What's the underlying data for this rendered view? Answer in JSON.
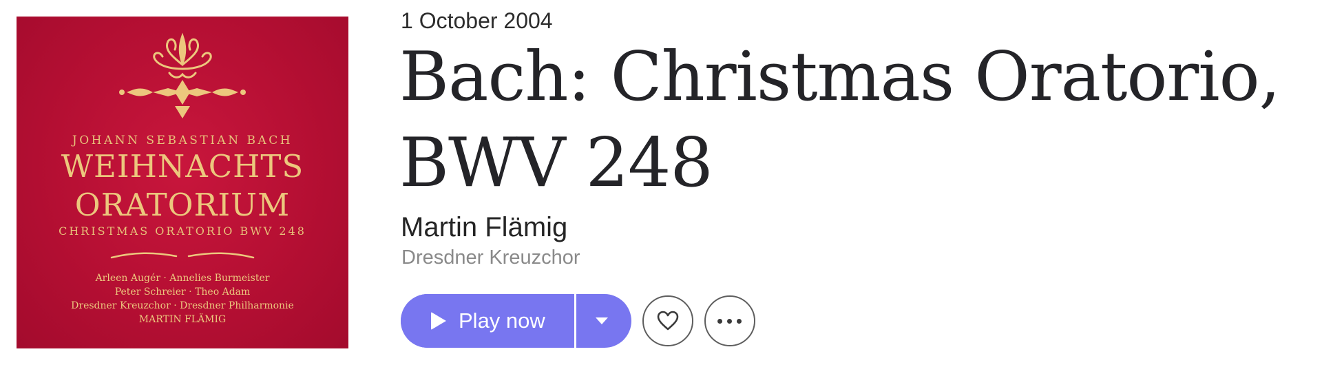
{
  "cover": {
    "composer": "JOHANN SEBASTIAN BACH",
    "title_line1": "WEIHNACHTS",
    "title_line2": "ORATORIUM",
    "subtitle": "CHRISTMAS ORATORIO BWV 248",
    "performers": [
      "Arleen Augér · Annelies Burmeister",
      "Peter Schreier · Theo Adam",
      "Dresdner Kreuzchor · Dresdner Philharmonie",
      "MARTIN FLÄMIG"
    ],
    "background_color": "#b50f33",
    "lettering_color": "#ecc77d"
  },
  "album": {
    "release_date": "1 October 2004",
    "title": "Bach: Christmas Oratorio, BWV 248",
    "artist": "Martin Flämig",
    "ensemble": "Dresdner Kreuzchor"
  },
  "actions": {
    "play_label": "Play now",
    "play_icon": "play-icon",
    "dropdown_icon": "chevron-down-icon",
    "favorite_icon": "heart-icon",
    "more_icon": "more-options-icon",
    "accent_color": "#7876f0"
  }
}
